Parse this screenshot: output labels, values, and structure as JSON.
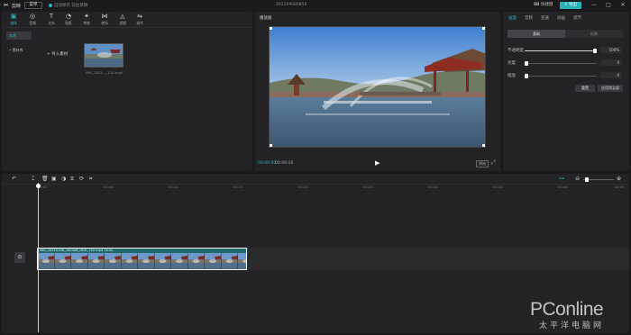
{
  "titlebar": {
    "app_name": "剪映",
    "menu_label": "菜单",
    "status_text": "自动保存 前往草稿",
    "project_name": "202109080856",
    "shortcut_label": "快捷键",
    "export_label": "导出",
    "minimize": "—",
    "maximize": "□",
    "close": "✕"
  },
  "media_tools": [
    {
      "label": "媒体",
      "icon": "media-icon",
      "glyph": "▣"
    },
    {
      "label": "音频",
      "icon": "audio-icon",
      "glyph": "◎"
    },
    {
      "label": "文本",
      "icon": "text-icon",
      "glyph": "T"
    },
    {
      "label": "贴纸",
      "icon": "sticker-icon",
      "glyph": "◔"
    },
    {
      "label": "特效",
      "icon": "effects-icon",
      "glyph": "✦"
    },
    {
      "label": "转场",
      "icon": "transition-icon",
      "glyph": "⋈"
    },
    {
      "label": "滤镜",
      "icon": "filter-icon",
      "glyph": "◬"
    },
    {
      "label": "调节",
      "icon": "adjust-icon",
      "glyph": "⇋"
    }
  ],
  "side_nav": [
    {
      "label": "本地"
    },
    {
      "label": "• 素材库"
    }
  ],
  "import_label": "导入素材",
  "media_item": {
    "label": "IMG_2021..._120.mp4"
  },
  "preview": {
    "title": "播放器",
    "current_time": "00:00:00",
    "total_time": "00:00:16",
    "ratio_label": "原始"
  },
  "inspector": {
    "tabs": [
      "画面",
      "音频",
      "变速",
      "动画",
      "调节"
    ],
    "segment": [
      "基础",
      "抠像"
    ],
    "rows": [
      {
        "label": "不透明度",
        "value": "100%",
        "level": 1.0
      },
      {
        "label": "亮度",
        "value": "0",
        "level": 0.0
      },
      {
        "label": "缩放",
        "value": "0",
        "level": 0.0
      }
    ],
    "reset_label": "重置",
    "apply_all_label": "应用到全部"
  },
  "timeline": {
    "ticks": [
      "00:00",
      "00:05",
      "00:10",
      "00:15",
      "00:20",
      "00:25",
      "00:30",
      "00:35",
      "00:40",
      "00:45"
    ],
    "clip_label": "IMG_20210106_162408_HDR_120.mp4   16.0s"
  },
  "watermark": {
    "main": "PConline",
    "sub": "太平洋电脑网"
  },
  "colors": {
    "accent": "#27b3b8",
    "panel": "#232326",
    "background": "#1a1a1c"
  }
}
